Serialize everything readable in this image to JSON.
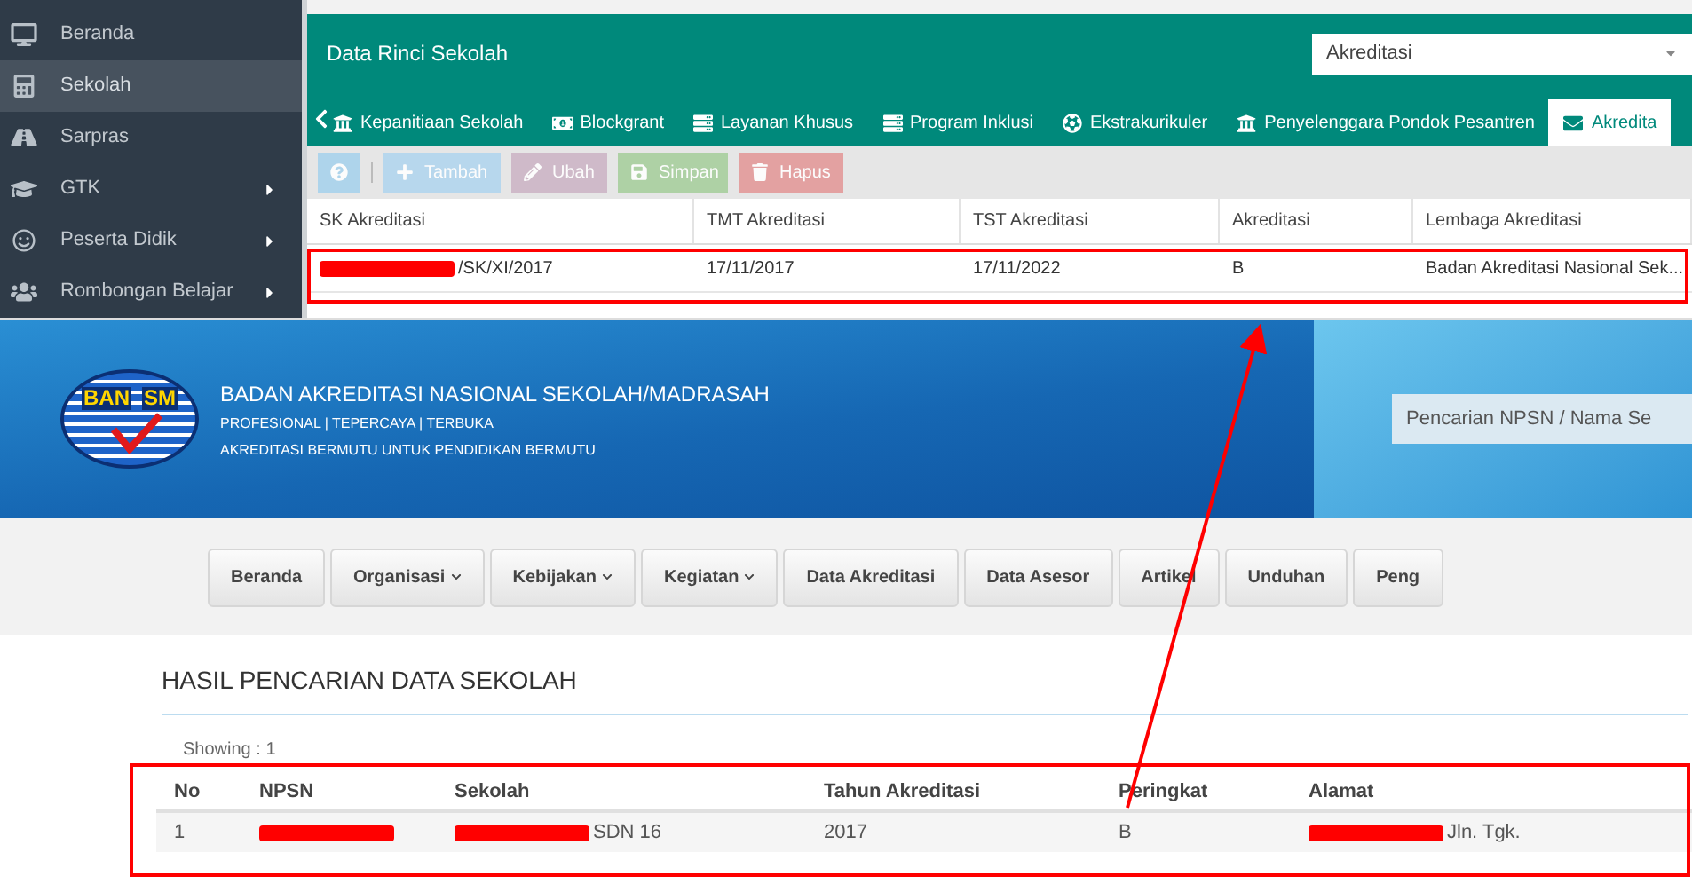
{
  "sidebar": {
    "items": [
      {
        "label": "Beranda",
        "selected": false,
        "has_submenu": false
      },
      {
        "label": "Sekolah",
        "selected": true,
        "has_submenu": false
      },
      {
        "label": "Sarpras",
        "selected": false,
        "has_submenu": false
      },
      {
        "label": "GTK",
        "selected": false,
        "has_submenu": true
      },
      {
        "label": "Peserta Didik",
        "selected": false,
        "has_submenu": true
      },
      {
        "label": "Rombongan Belajar",
        "selected": false,
        "has_submenu": true
      }
    ]
  },
  "panel": {
    "title": "Data Rinci Sekolah",
    "select": {
      "value": "Akreditasi"
    },
    "tabs": [
      {
        "label": "Kepanitiaan Sekolah",
        "selected": false
      },
      {
        "label": "Blockgrant",
        "selected": false
      },
      {
        "label": "Layanan Khusus",
        "selected": false
      },
      {
        "label": "Program Inklusi",
        "selected": false
      },
      {
        "label": "Ekstrakurikuler",
        "selected": false
      },
      {
        "label": "Penyelenggara Pondok Pesantren",
        "selected": false
      },
      {
        "label": "Akredita",
        "selected": true
      }
    ],
    "toolbar": [
      {
        "kind": "help",
        "disabled": true
      },
      {
        "kind": "add",
        "label": "Tambah",
        "disabled": true
      },
      {
        "kind": "edit",
        "label": "Ubah",
        "disabled": true
      },
      {
        "kind": "save",
        "label": "Simpan",
        "disabled": true
      },
      {
        "kind": "delete",
        "label": "Hapus",
        "disabled": true
      }
    ],
    "table": {
      "columns": [
        "SK Akreditasi",
        "TMT Akreditasi",
        "TST Akreditasi",
        "Akreditasi",
        "Lembaga Akreditasi"
      ],
      "rows": [
        {
          "cells": [
            {
              "text": "/SK/XI/2017",
              "redacted": true
            },
            {
              "text": "17/11/2017",
              "redacted": false
            },
            {
              "text": "17/11/2022",
              "redacted": false
            },
            {
              "text": "B",
              "redacted": false
            },
            {
              "text": "Badan Akreditasi Nasional Sek...",
              "redacted": false
            }
          ]
        }
      ]
    }
  },
  "banner": {
    "logo": [
      "BAN",
      "SM"
    ],
    "title": "BADAN AKREDITASI NASIONAL SEKOLAH/MADRASAH",
    "tagline": "PROFESIONAL | TEPERCAYA  | TERBUKA",
    "motto": "AKREDITASI BERMUTU UNTUK PENDIDIKAN BERMUTU",
    "search": {
      "placeholder": "Pencarian NPSN / Nama Se"
    }
  },
  "nav": {
    "items": [
      {
        "label": "Beranda",
        "has_dropdown": false
      },
      {
        "label": "Organisasi",
        "has_dropdown": true
      },
      {
        "label": "Kebijakan",
        "has_dropdown": true
      },
      {
        "label": "Kegiatan",
        "has_dropdown": true
      },
      {
        "label": "Data Akreditasi",
        "has_dropdown": false
      },
      {
        "label": "Data Asesor",
        "has_dropdown": false
      },
      {
        "label": "Artikel",
        "has_dropdown": false
      },
      {
        "label": "Unduhan",
        "has_dropdown": false
      },
      {
        "label": "Peng",
        "has_dropdown": false
      }
    ]
  },
  "results": {
    "heading": "HASIL PENCARIAN DATA SEKOLAH",
    "showing": "Showing : 1",
    "columns": [
      "No",
      "NPSN",
      "Sekolah",
      "Tahun Akreditasi",
      "Peringkat",
      "Alamat"
    ],
    "rows": [
      {
        "cells": [
          {
            "text": "1",
            "redacted": false
          },
          {
            "text": "",
            "redacted": true
          },
          {
            "text": "SDN 16",
            "redacted": true
          },
          {
            "text": "2017",
            "redacted": false
          },
          {
            "text": "B",
            "redacted": false
          },
          {
            "text": "Jln. Tgk.",
            "redacted": true
          }
        ]
      }
    ]
  }
}
